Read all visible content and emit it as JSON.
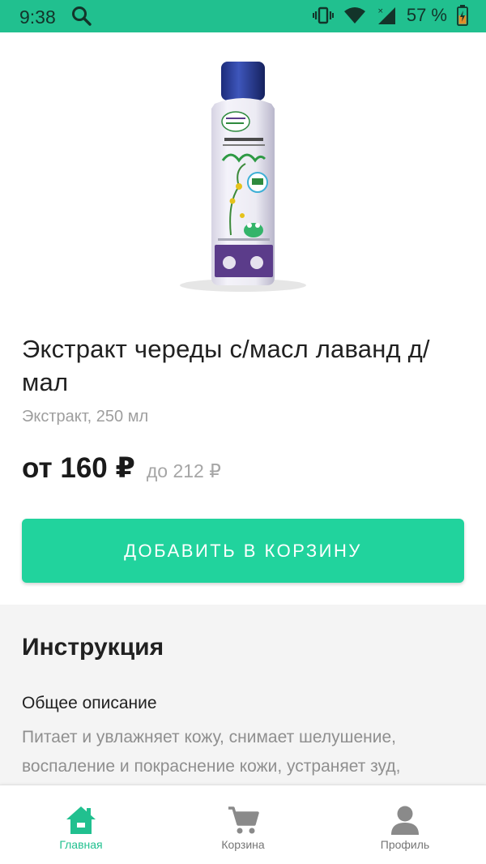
{
  "status_bar": {
    "time": "9:38",
    "battery_percent": "57 %",
    "icons": [
      "search-icon",
      "vibrate-icon",
      "wifi-icon",
      "signal-icon",
      "battery-icon"
    ],
    "background_color": "#21c08f"
  },
  "product": {
    "title": "Экстракт череды с/масл лаванд д/мал",
    "subtitle": "Экстракт, 250 мл",
    "price_from": "от 160 ₽",
    "price_to": "до 212 ₽",
    "add_to_cart_label": "ДОБАВИТЬ В КОРЗИНУ"
  },
  "instruction": {
    "title": "Инструкция",
    "subheading": "Общее описание",
    "text": "Питает и увлажняет кожу, снимает шелушение, воспаление и покраснение кожи, устраняет зуд,"
  },
  "bottom_nav": {
    "items": [
      {
        "label": "Главная",
        "icon": "home-icon",
        "active": true
      },
      {
        "label": "Корзина",
        "icon": "cart-icon",
        "active": false
      },
      {
        "label": "Профиль",
        "icon": "profile-icon",
        "active": false
      }
    ],
    "active_color": "#21c08f"
  },
  "colors": {
    "accent": "#21d39d",
    "primary_text": "#212121",
    "secondary_text": "#9e9e9e"
  }
}
